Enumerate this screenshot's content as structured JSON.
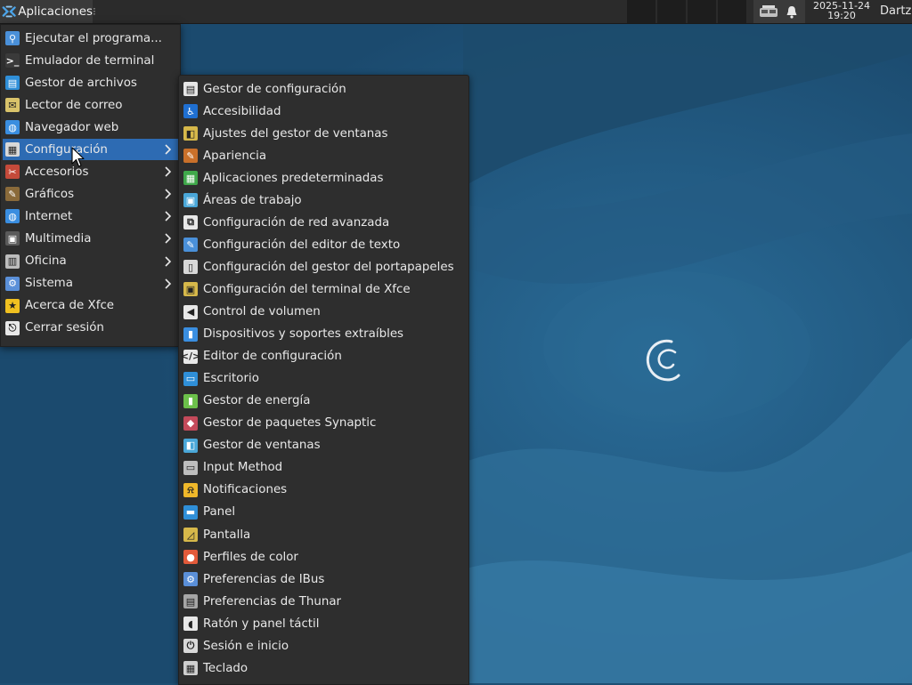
{
  "panel": {
    "apps_label": "Aplicaciones",
    "clock_date": "2025-11-24",
    "clock_time": "19:20",
    "user": "Dartz"
  },
  "main_menu": [
    {
      "label": "Ejecutar el programa...",
      "icon": "run-program-icon",
      "submenu": false
    },
    {
      "label": "Emulador de terminal",
      "icon": "terminal-icon",
      "submenu": false
    },
    {
      "label": "Gestor de archivos",
      "icon": "file-manager-icon",
      "submenu": false
    },
    {
      "label": "Lector de correo",
      "icon": "mail-icon",
      "submenu": false
    },
    {
      "label": "Navegador web",
      "icon": "web-browser-icon",
      "submenu": false
    },
    {
      "label": "Configuración",
      "icon": "settings-icon",
      "submenu": true,
      "active": true
    },
    {
      "label": "Accesorios",
      "icon": "accessories-icon",
      "submenu": true
    },
    {
      "label": "Gráficos",
      "icon": "graphics-icon",
      "submenu": true
    },
    {
      "label": "Internet",
      "icon": "internet-icon",
      "submenu": true
    },
    {
      "label": "Multimedia",
      "icon": "multimedia-icon",
      "submenu": true
    },
    {
      "label": "Oficina",
      "icon": "office-icon",
      "submenu": true
    },
    {
      "label": "Sistema",
      "icon": "system-icon",
      "submenu": true
    },
    {
      "label": "Acerca de Xfce",
      "icon": "star-icon",
      "submenu": false
    },
    {
      "label": "Cerrar sesión",
      "icon": "logout-icon",
      "submenu": false
    }
  ],
  "settings_submenu": [
    {
      "label": "Gestor de configuración",
      "icon": "settings-manager-icon",
      "color": "#e6e6e6"
    },
    {
      "label": "Accesibilidad",
      "icon": "accessibility-icon",
      "color": "#1f6fd1"
    },
    {
      "label": "Ajustes del gestor de ventanas",
      "icon": "window-tweaks-icon",
      "color": "#d6b84a"
    },
    {
      "label": "Apariencia",
      "icon": "appearance-icon",
      "color": "#c9702a"
    },
    {
      "label": "Aplicaciones predeterminadas",
      "icon": "default-apps-icon",
      "color": "#3fa84a"
    },
    {
      "label": "Áreas de trabajo",
      "icon": "workspaces-icon",
      "color": "#4aa7d8"
    },
    {
      "label": "Configuración de red avanzada",
      "icon": "network-icon",
      "color": "#e8e8e8"
    },
    {
      "label": "Configuración del editor de texto",
      "icon": "text-editor-icon",
      "color": "#4a90d9"
    },
    {
      "label": "Configuración del gestor del portapapeles",
      "icon": "clipboard-icon",
      "color": "#d8d8d8"
    },
    {
      "label": "Configuración del terminal de Xfce",
      "icon": "terminal-settings-icon",
      "color": "#d6b84a"
    },
    {
      "label": "Control de volumen",
      "icon": "volume-icon",
      "color": "#e8e8e8"
    },
    {
      "label": "Dispositivos y soportes extraíbles",
      "icon": "removable-devices-icon",
      "color": "#3a8ee0"
    },
    {
      "label": "Editor de configuración",
      "icon": "config-editor-icon",
      "color": "#e8e8e8"
    },
    {
      "label": "Escritorio",
      "icon": "desktop-icon",
      "color": "#2f8fd8"
    },
    {
      "label": "Gestor de energía",
      "icon": "power-manager-icon",
      "color": "#6cc04a"
    },
    {
      "label": "Gestor de paquetes Synaptic",
      "icon": "synaptic-icon",
      "color": "#c44a5a"
    },
    {
      "label": "Gestor de ventanas",
      "icon": "window-manager-icon",
      "color": "#4aa7d8"
    },
    {
      "label": "Input Method",
      "icon": "keyboard-input-icon",
      "color": "#bdbdbd"
    },
    {
      "label": "Notificaciones",
      "icon": "bell-icon",
      "color": "#f0b82a"
    },
    {
      "label": "Panel",
      "icon": "panel-icon",
      "color": "#2f8fd8"
    },
    {
      "label": "Pantalla",
      "icon": "display-icon",
      "color": "#d6b84a"
    },
    {
      "label": "Perfiles de color",
      "icon": "color-profiles-icon",
      "color": "#e25a3a"
    },
    {
      "label": "Preferencias de IBus",
      "icon": "ibus-gear-icon",
      "color": "#5a8fd8"
    },
    {
      "label": "Preferencias de Thunar",
      "icon": "thunar-icon",
      "color": "#a6a6a6"
    },
    {
      "label": "Ratón y panel táctil",
      "icon": "mouse-icon",
      "color": "#e8e8e8"
    },
    {
      "label": "Sesión e inicio",
      "icon": "session-icon",
      "color": "#d9d9d9"
    },
    {
      "label": "Teclado",
      "icon": "keyboard-icon",
      "color": "#cfcfcf"
    }
  ]
}
